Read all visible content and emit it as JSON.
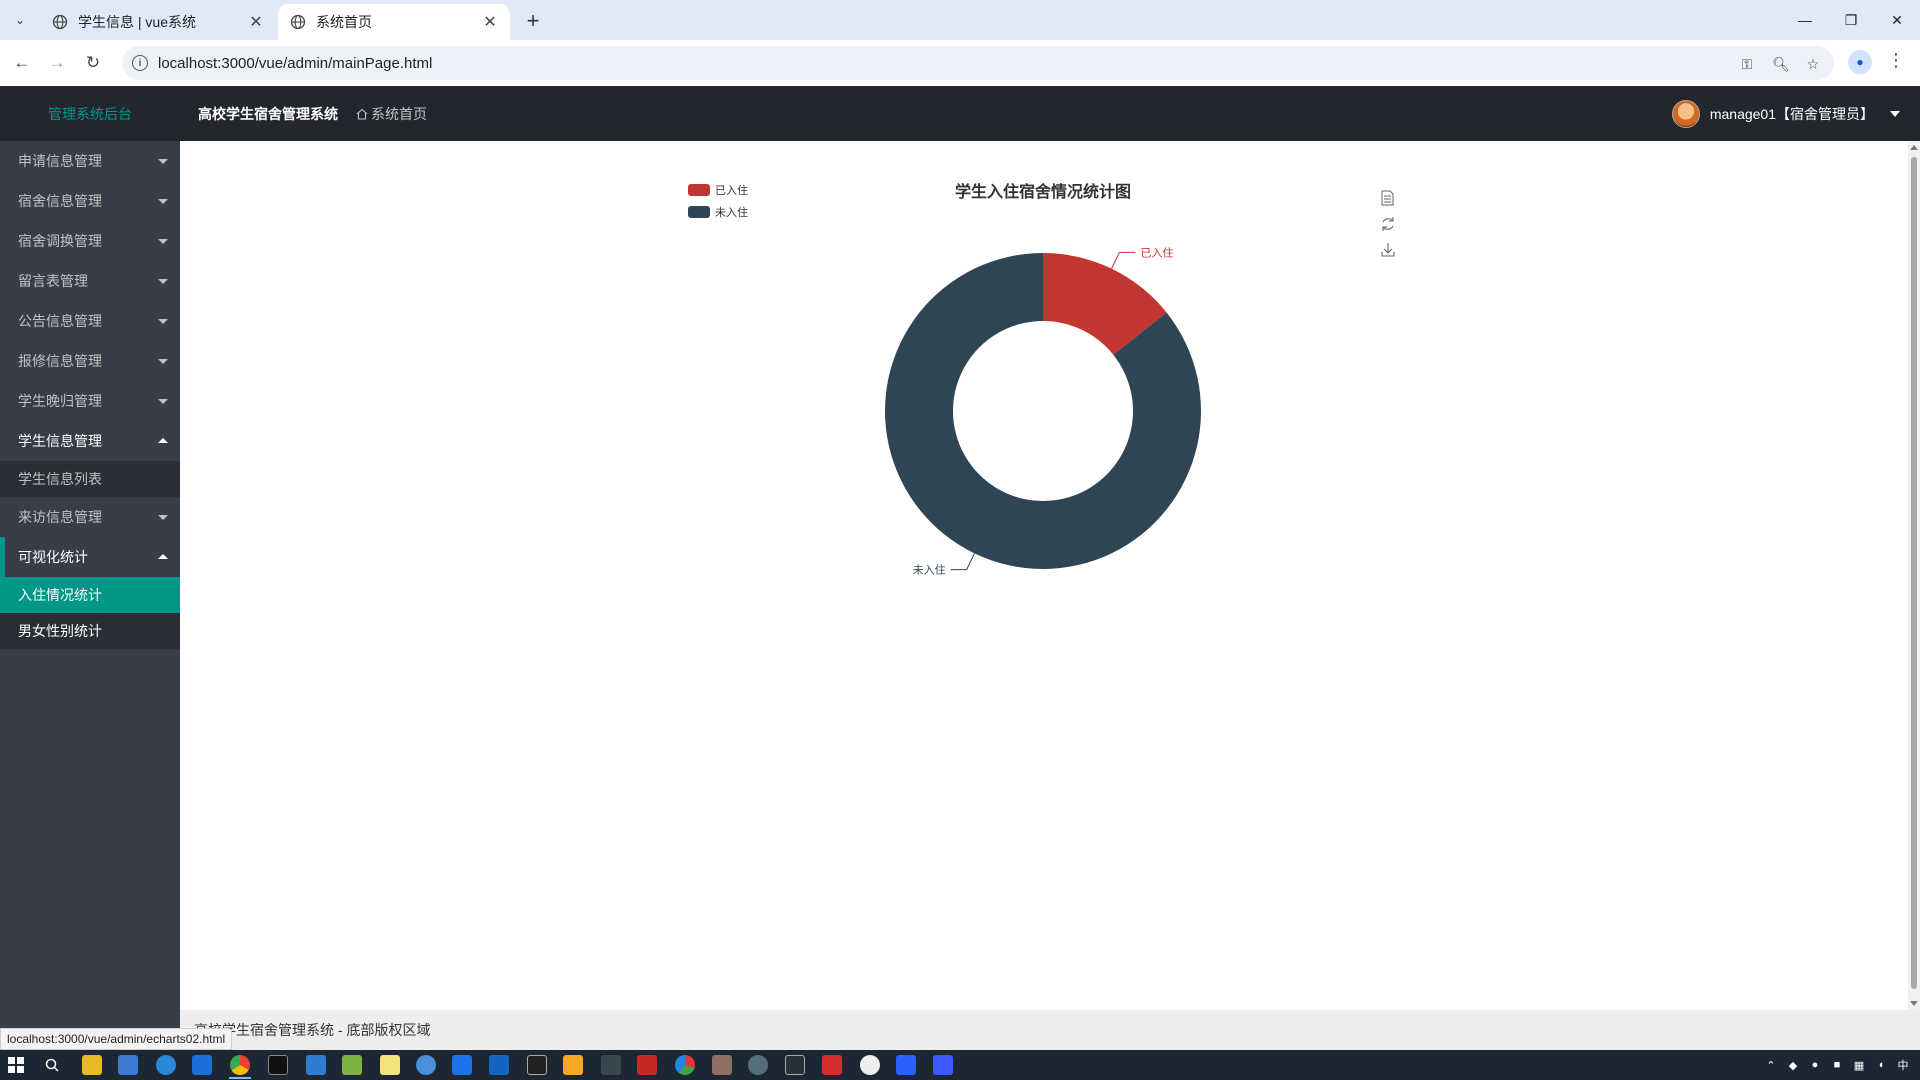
{
  "browser": {
    "tabs": [
      {
        "title": "学生信息 | vue系统",
        "active": false
      },
      {
        "title": "系统首页",
        "active": true
      }
    ],
    "url": "localhost:3000/vue/admin/mainPage.html",
    "status_url": "localhost:3000/vue/admin/echarts02.html"
  },
  "header": {
    "logo": "管理系统后台",
    "system_name": "高校学生宿舍管理系统",
    "home_link": "系统首页",
    "user": "manage01【宿舍管理员】"
  },
  "sidebar": {
    "items": [
      {
        "label": "申请信息管理",
        "open": false
      },
      {
        "label": "宿舍信息管理",
        "open": false
      },
      {
        "label": "宿舍调换管理",
        "open": false
      },
      {
        "label": "留言表管理",
        "open": false
      },
      {
        "label": "公告信息管理",
        "open": false
      },
      {
        "label": "报修信息管理",
        "open": false
      },
      {
        "label": "学生晚归管理",
        "open": false
      },
      {
        "label": "学生信息管理",
        "open": true,
        "children": [
          "学生信息列表"
        ]
      },
      {
        "label": "来访信息管理",
        "open": false
      },
      {
        "label": "可视化统计",
        "open": true,
        "children": [
          "入住情况统计",
          "男女性别统计"
        ]
      }
    ],
    "selected": "入住情况统计"
  },
  "chart_data": {
    "type": "pie",
    "title": "学生入住宿舍情况统计图",
    "series": [
      {
        "name": "已入住",
        "value": 1,
        "color": "#c23531"
      },
      {
        "name": "未入住",
        "value": 6,
        "color": "#2f4554"
      }
    ],
    "legend": [
      "已入住",
      "未入住"
    ],
    "legend_position": "top-left",
    "donut": true
  },
  "toolbox": [
    "data-view-icon",
    "refresh-icon",
    "download-icon"
  ],
  "footer": {
    "text": "高校学生宿舍管理系统 - 底部版权区域"
  },
  "colors": {
    "accent": "#009688",
    "header_bg": "#23262e",
    "sidebar_bg": "#393d49"
  }
}
